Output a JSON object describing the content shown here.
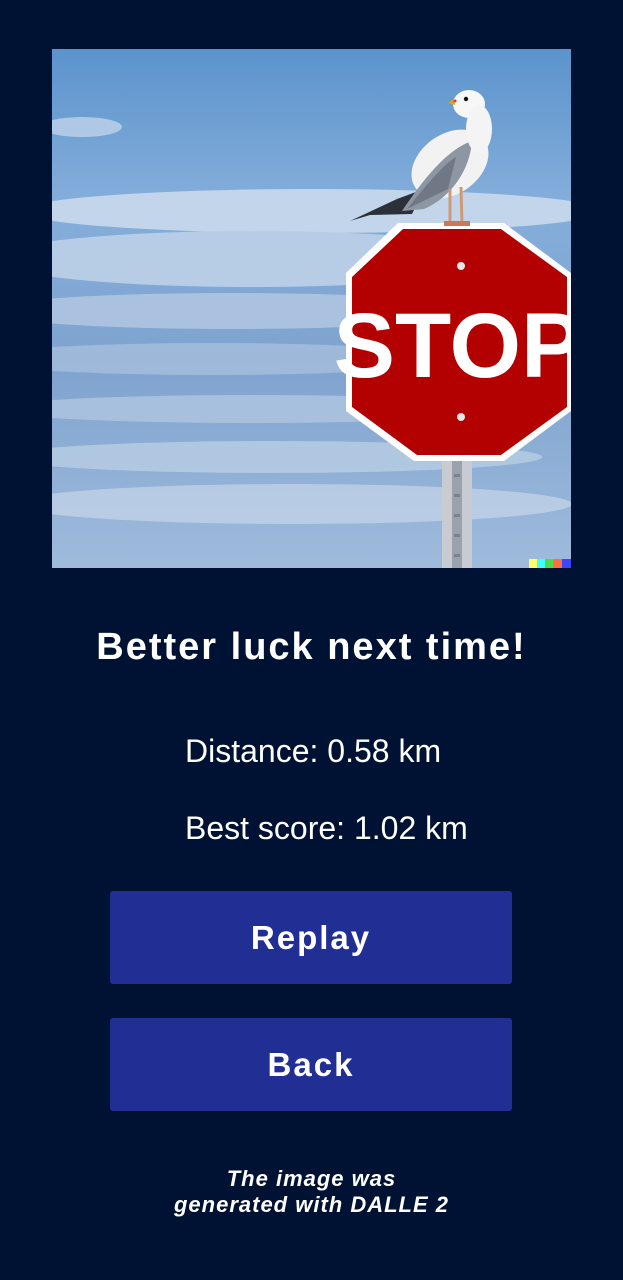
{
  "result": {
    "headline": "Better luck next time!",
    "distance_text": "Distance: 0.58 km",
    "best_score_text": "Best score: 1.02 km"
  },
  "image": {
    "sign_text": "STOP"
  },
  "actions": {
    "replay_label": "Replay",
    "back_label": "Back"
  },
  "credit": {
    "line1": "The image was",
    "line2": "generated with DALLE 2"
  },
  "colors": {
    "background": "#001233",
    "button": "#212f95",
    "sign_red": "#b30000"
  }
}
